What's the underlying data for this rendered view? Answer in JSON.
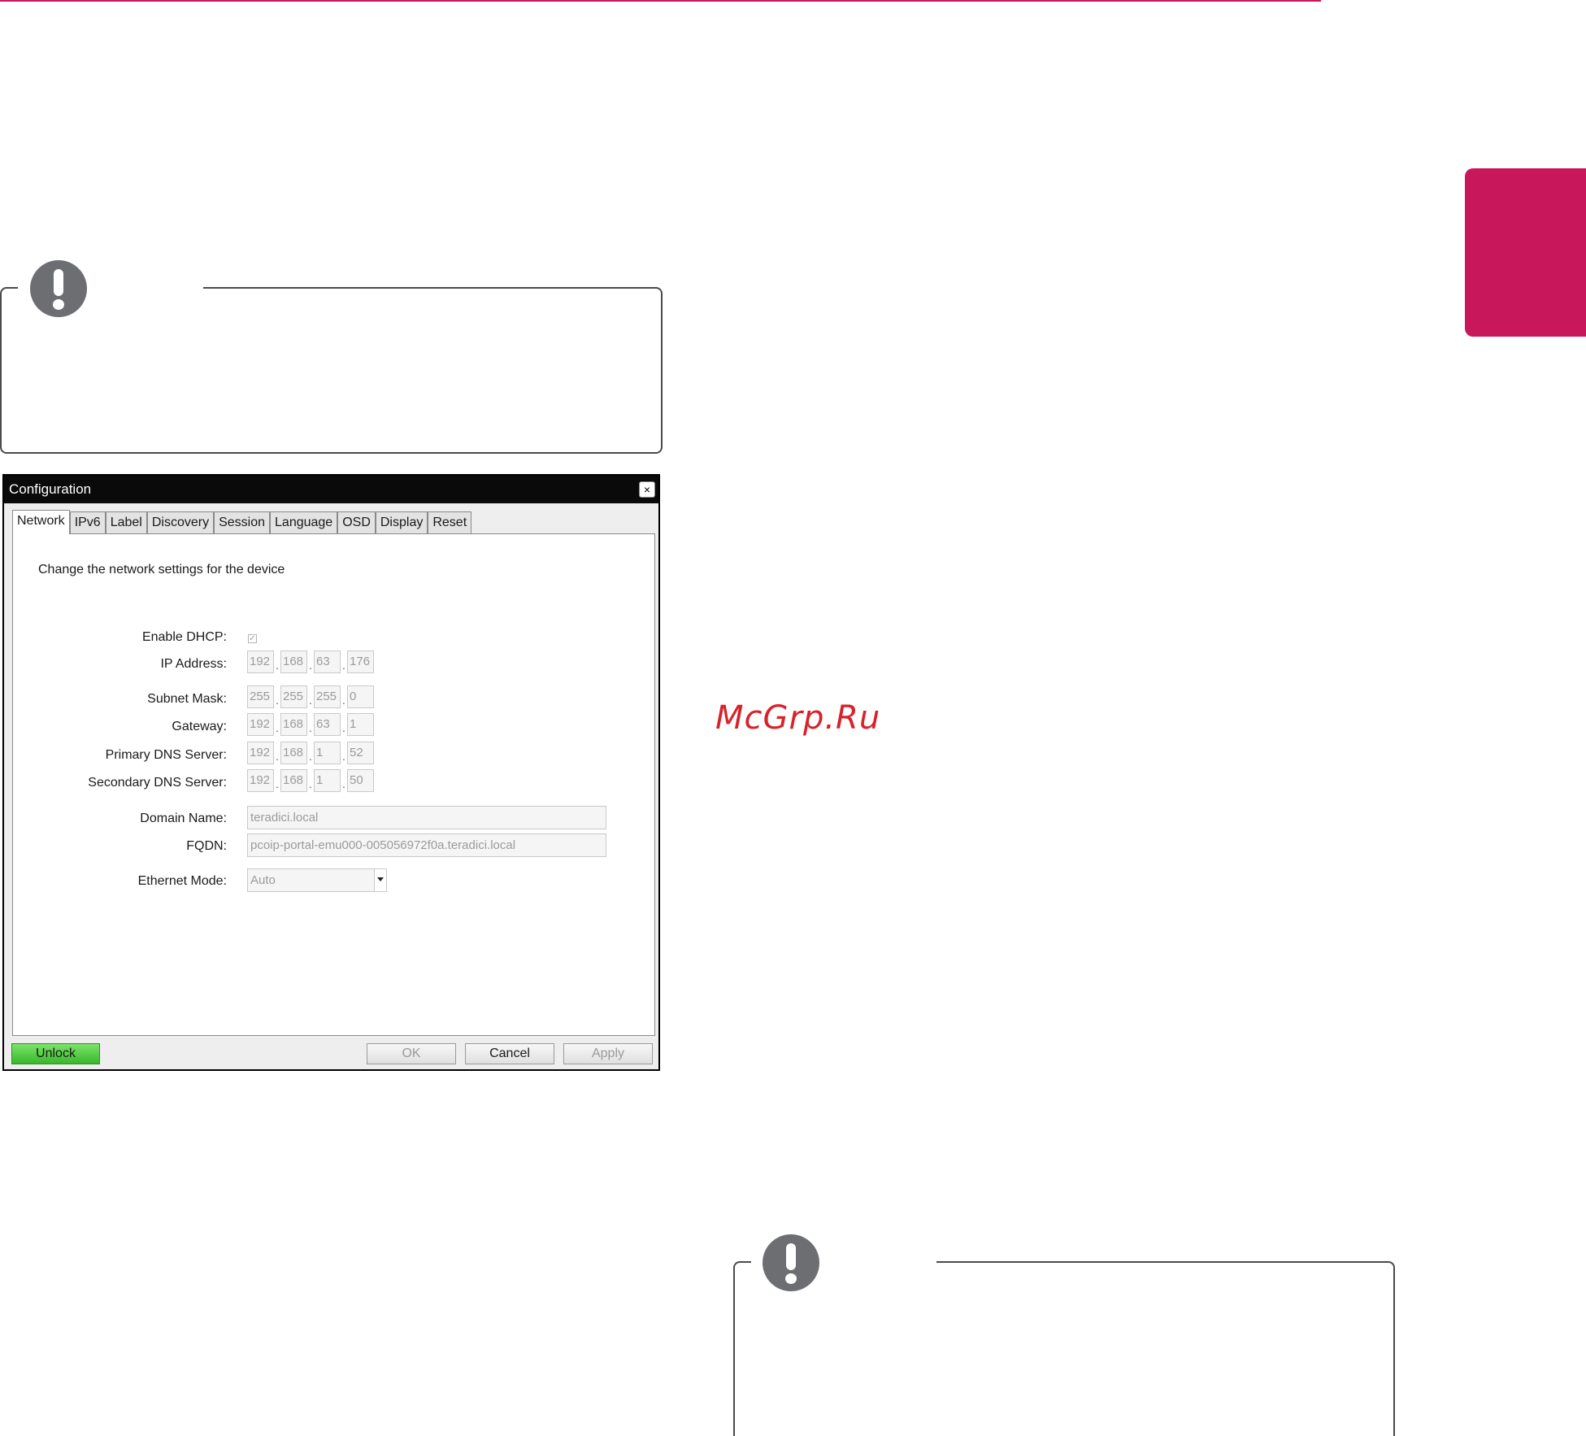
{
  "page": {
    "accent_color": "#c8175a",
    "watermark": "McGrp.Ru"
  },
  "dialog": {
    "title": "Configuration",
    "close_label": "×",
    "tabs": [
      {
        "label": "Network",
        "active": true
      },
      {
        "label": "IPv6",
        "active": false
      },
      {
        "label": "Label",
        "active": false
      },
      {
        "label": "Discovery",
        "active": false
      },
      {
        "label": "Session",
        "active": false
      },
      {
        "label": "Language",
        "active": false
      },
      {
        "label": "OSD",
        "active": false
      },
      {
        "label": "Display",
        "active": false
      },
      {
        "label": "Reset",
        "active": false
      }
    ],
    "description": "Change the network settings for the device",
    "fields": {
      "enable_dhcp": {
        "label": "Enable DHCP:",
        "checked": true,
        "check_mark": "✓"
      },
      "ip_address": {
        "label": "IP Address:",
        "octets": [
          "192",
          "168",
          "63",
          "176"
        ]
      },
      "subnet_mask": {
        "label": "Subnet Mask:",
        "octets": [
          "255",
          "255",
          "255",
          "0"
        ]
      },
      "gateway": {
        "label": "Gateway:",
        "octets": [
          "192",
          "168",
          "63",
          "1"
        ]
      },
      "primary_dns": {
        "label": "Primary DNS Server:",
        "octets": [
          "192",
          "168",
          "1",
          "52"
        ]
      },
      "secondary_dns": {
        "label": "Secondary DNS Server:",
        "octets": [
          "192",
          "168",
          "1",
          "50"
        ]
      },
      "domain_name": {
        "label": "Domain Name:",
        "value": "teradici.local"
      },
      "fqdn": {
        "label": "FQDN:",
        "value": "pcoip-portal-emu000-005056972f0a.teradici.local"
      },
      "ethernet_mode": {
        "label": "Ethernet Mode:",
        "value": "Auto"
      }
    },
    "buttons": {
      "unlock": "Unlock",
      "ok": "OK",
      "cancel": "Cancel",
      "apply": "Apply"
    },
    "unlock_color": "#38b82a"
  },
  "notes": [
    {
      "icon": "exclamation-icon"
    },
    {
      "icon": "exclamation-icon"
    }
  ]
}
